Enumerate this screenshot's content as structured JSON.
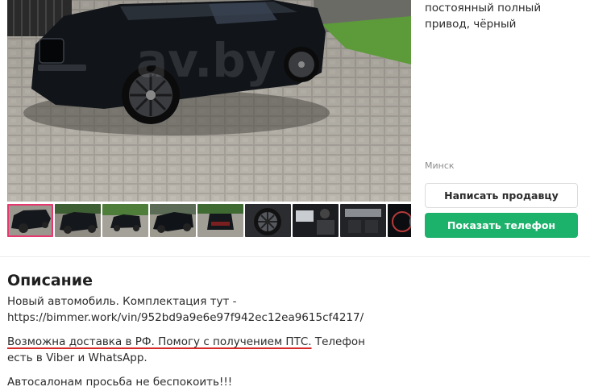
{
  "listing": {
    "specs_text": "постоянный полный привод, чёрный",
    "city": "Минск",
    "buttons": {
      "write_seller": "Написать продавцу",
      "show_phone": "Показать телефон"
    }
  },
  "gallery": {
    "active_index": 0,
    "thumbnail_count": 9
  },
  "description": {
    "title": "Описание",
    "line1": "Новый автомобиль. Комплектация тут - https://bimmer.work/vin/952bd9a9e6e97f942ec12ea9615cf4217/",
    "line2_underlined": "Возможна доставка в РФ. Помогу с получением ПТС.",
    "line2_rest": " Телефон есть в Viber и WhatsApp.",
    "line3": "Автосалонам просьба не беспокоить!!!"
  },
  "colors": {
    "accent_green": "#1db26b",
    "active_thumb": "#e5386e",
    "underline_red": "#d42a2a"
  }
}
